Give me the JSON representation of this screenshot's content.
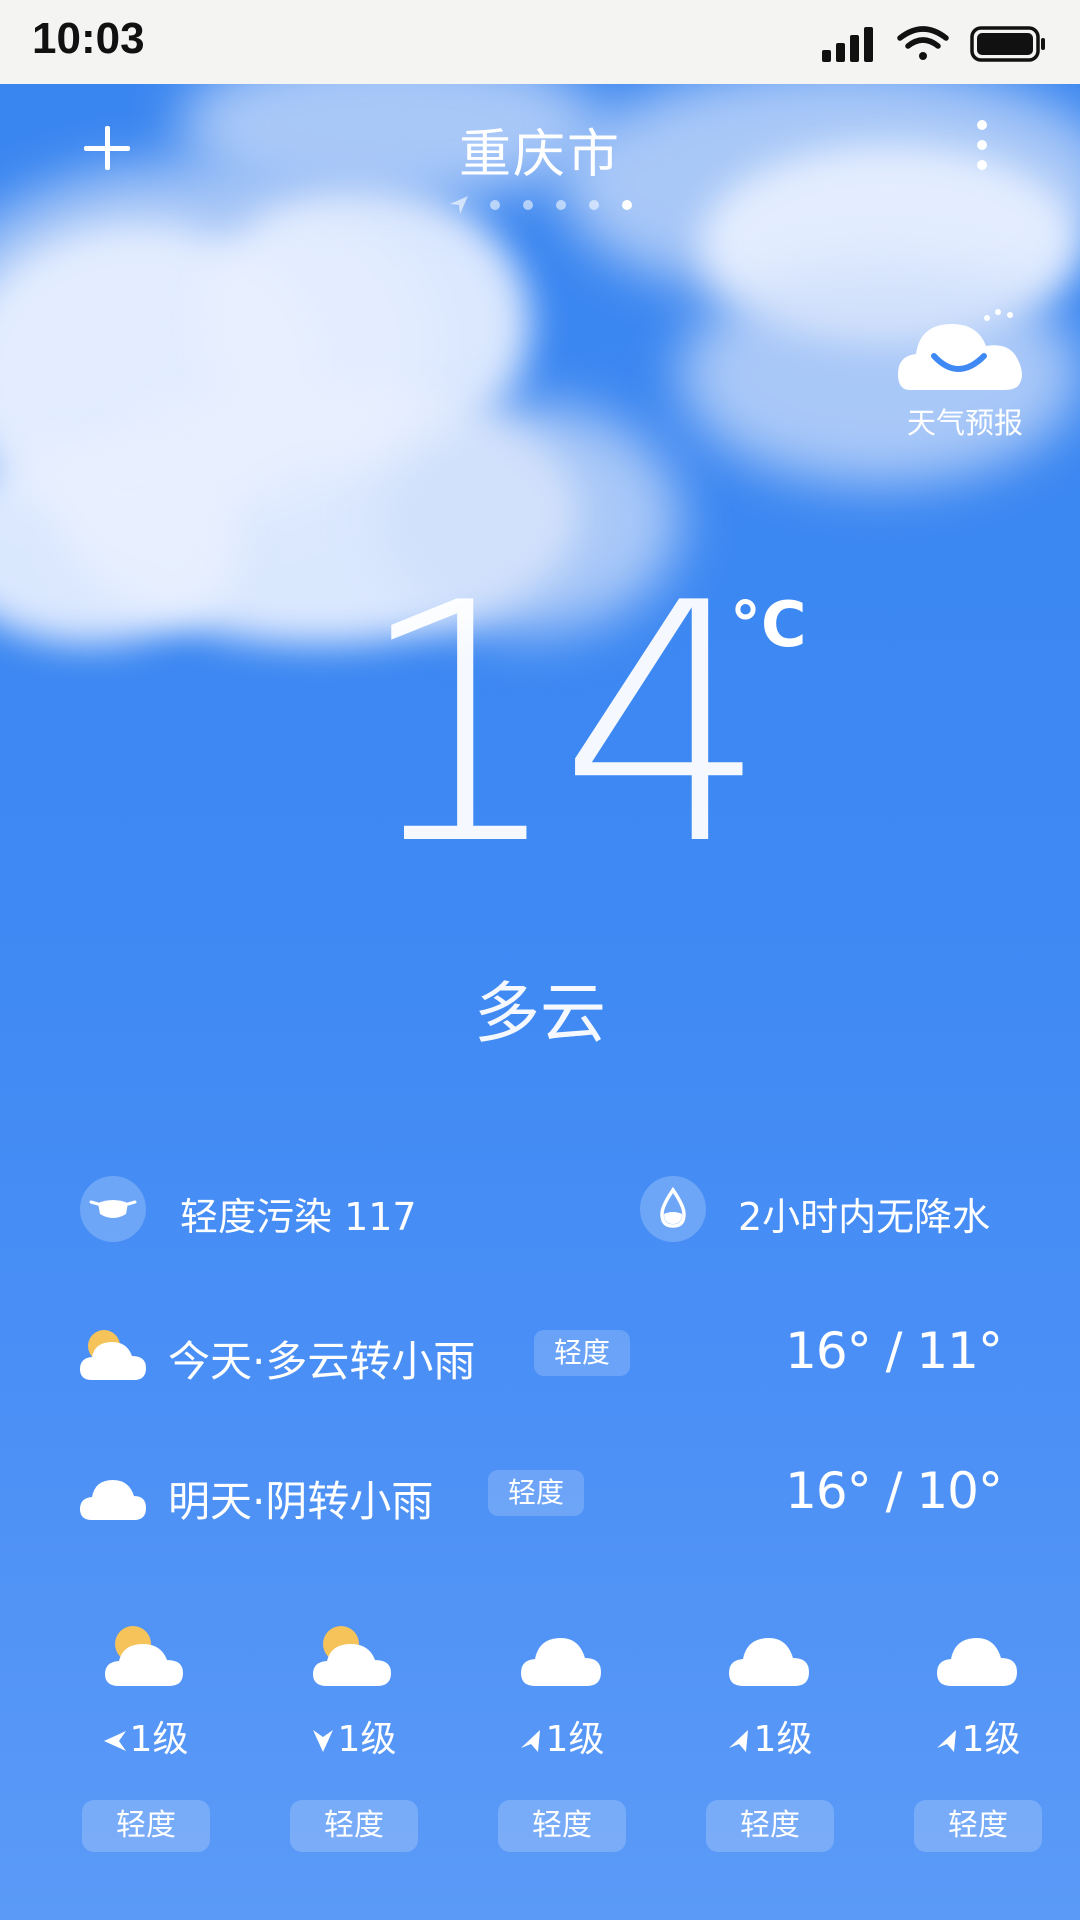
{
  "status_bar": {
    "time": "10:03"
  },
  "header": {
    "city": "重庆市"
  },
  "forecast_button": {
    "label": "天气预报"
  },
  "current": {
    "temperature": "14",
    "unit": "°C",
    "condition": "多云"
  },
  "info": {
    "air_quality": "轻度污染 117",
    "precipitation": "2小时内无降水"
  },
  "daily": [
    {
      "label": "今天·多云转小雨",
      "badge": "轻度",
      "temps": "16° / 11°",
      "icon": "partly-cloudy-icon"
    },
    {
      "label": "明天·阴转小雨",
      "badge": "轻度",
      "temps": "16° / 10°",
      "icon": "cloudy-icon"
    }
  ],
  "hourly": [
    {
      "icon": "partly-cloudy-icon",
      "wind": "1级",
      "badge": "轻度"
    },
    {
      "icon": "partly-cloudy-icon",
      "wind": "1级",
      "badge": "轻度"
    },
    {
      "icon": "cloudy-icon",
      "wind": "1级",
      "badge": "轻度"
    },
    {
      "icon": "cloudy-icon",
      "wind": "1级",
      "badge": "轻度"
    },
    {
      "icon": "cloudy-icon",
      "wind": "1级",
      "badge": "轻度"
    }
  ],
  "colors": {
    "sky": "#3e89f3",
    "text": "#ffffff",
    "sun": "#f6c35a"
  }
}
